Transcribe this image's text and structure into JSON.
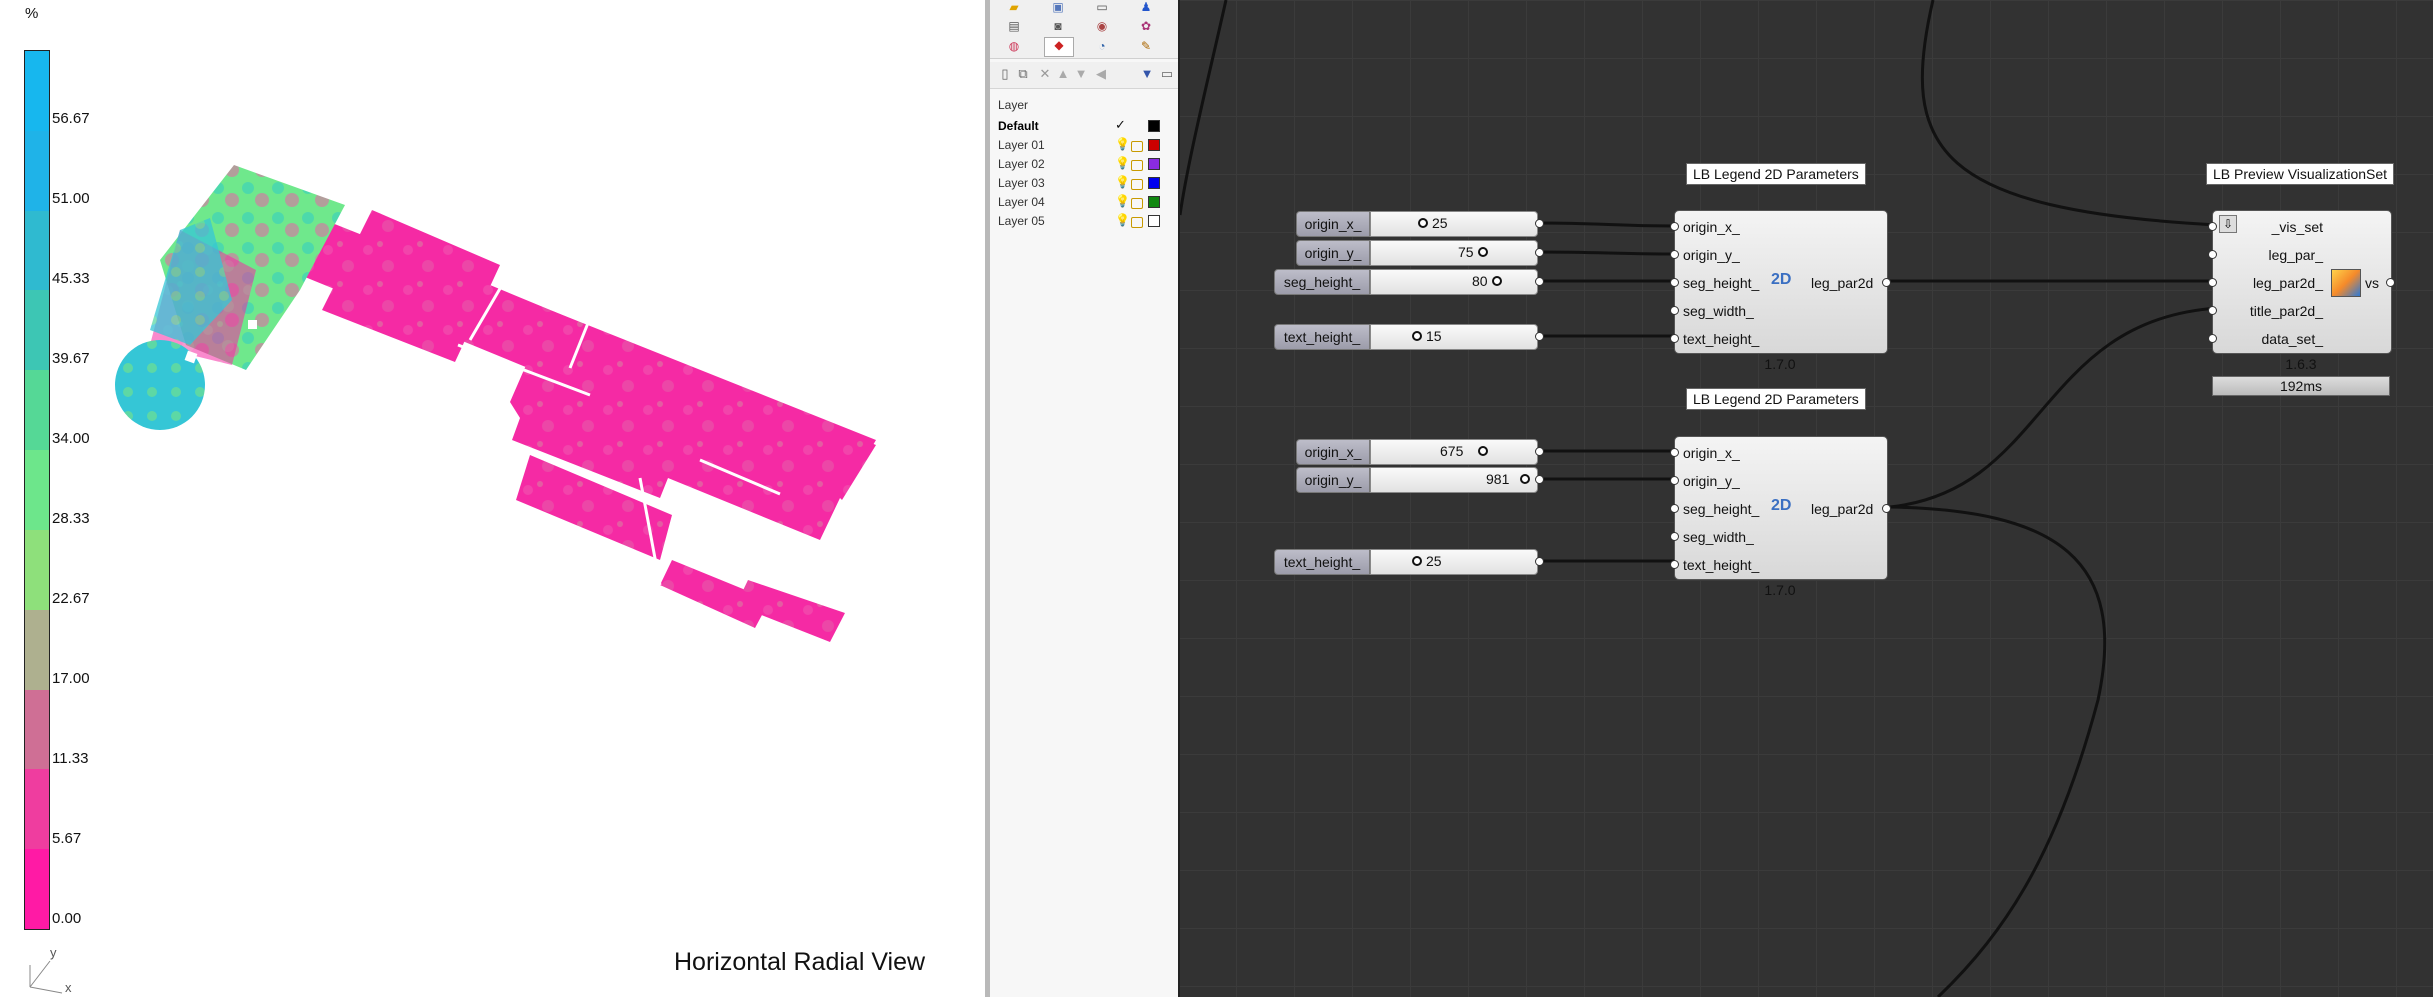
{
  "viewport": {
    "unit": "%",
    "legend_ticks": [
      "56.67",
      "51.00",
      "45.33",
      "39.67",
      "34.00",
      "28.33",
      "22.67",
      "17.00",
      "11.33",
      "5.67",
      "0.00"
    ],
    "legend_colors": [
      "#17b7ee",
      "#1fb3e8",
      "#2fbad0",
      "#3dc6b4",
      "#55d896",
      "#6de68b",
      "#8ee07b",
      "#aeb08f",
      "#cf6f95",
      "#ef3d9f",
      "#ff1aa5"
    ],
    "view_title": "Horizontal Radial View",
    "axis_y": "y",
    "axis_x": "x"
  },
  "layers": {
    "header": "Layer",
    "rows": [
      {
        "name": "Default",
        "current": true,
        "color": "#000000"
      },
      {
        "name": "Layer 01",
        "color": "#cc0000"
      },
      {
        "name": "Layer 02",
        "color": "#8a2be2"
      },
      {
        "name": "Layer 03",
        "color": "#0000ee"
      },
      {
        "name": "Layer 04",
        "color": "#118811"
      },
      {
        "name": "Layer 05",
        "color": "#ffffff"
      }
    ]
  },
  "grasshopper": {
    "group1": {
      "sliders": [
        {
          "label": "origin_x_",
          "value": "25"
        },
        {
          "label": "origin_y_",
          "value": "75"
        },
        {
          "label": "seg_height_",
          "value": "80"
        },
        {
          "label": "text_height_",
          "value": "15"
        }
      ],
      "title": "LB Legend 2D Parameters",
      "inputs": [
        "origin_x_",
        "origin_y_",
        "seg_height_",
        "seg_width_",
        "text_height_"
      ],
      "output": "leg_par2d",
      "version": "1.7.0"
    },
    "group2": {
      "sliders": [
        {
          "label": "origin_x_",
          "value": "675"
        },
        {
          "label": "origin_y_",
          "value": "981"
        },
        {
          "label": "text_height_",
          "value": "25"
        }
      ],
      "title": "LB Legend 2D Parameters",
      "inputs": [
        "origin_x_",
        "origin_y_",
        "seg_height_",
        "seg_width_",
        "text_height_"
      ],
      "output": "leg_par2d",
      "version": "1.7.0"
    },
    "preview": {
      "title": "LB Preview VisualizationSet",
      "inputs": [
        "_vis_set",
        "leg_par_",
        "leg_par2d_",
        "title_par2d_",
        "data_set_"
      ],
      "output": "vs",
      "version": "1.6.3",
      "timer": "192ms"
    },
    "icon_text": "2D"
  }
}
